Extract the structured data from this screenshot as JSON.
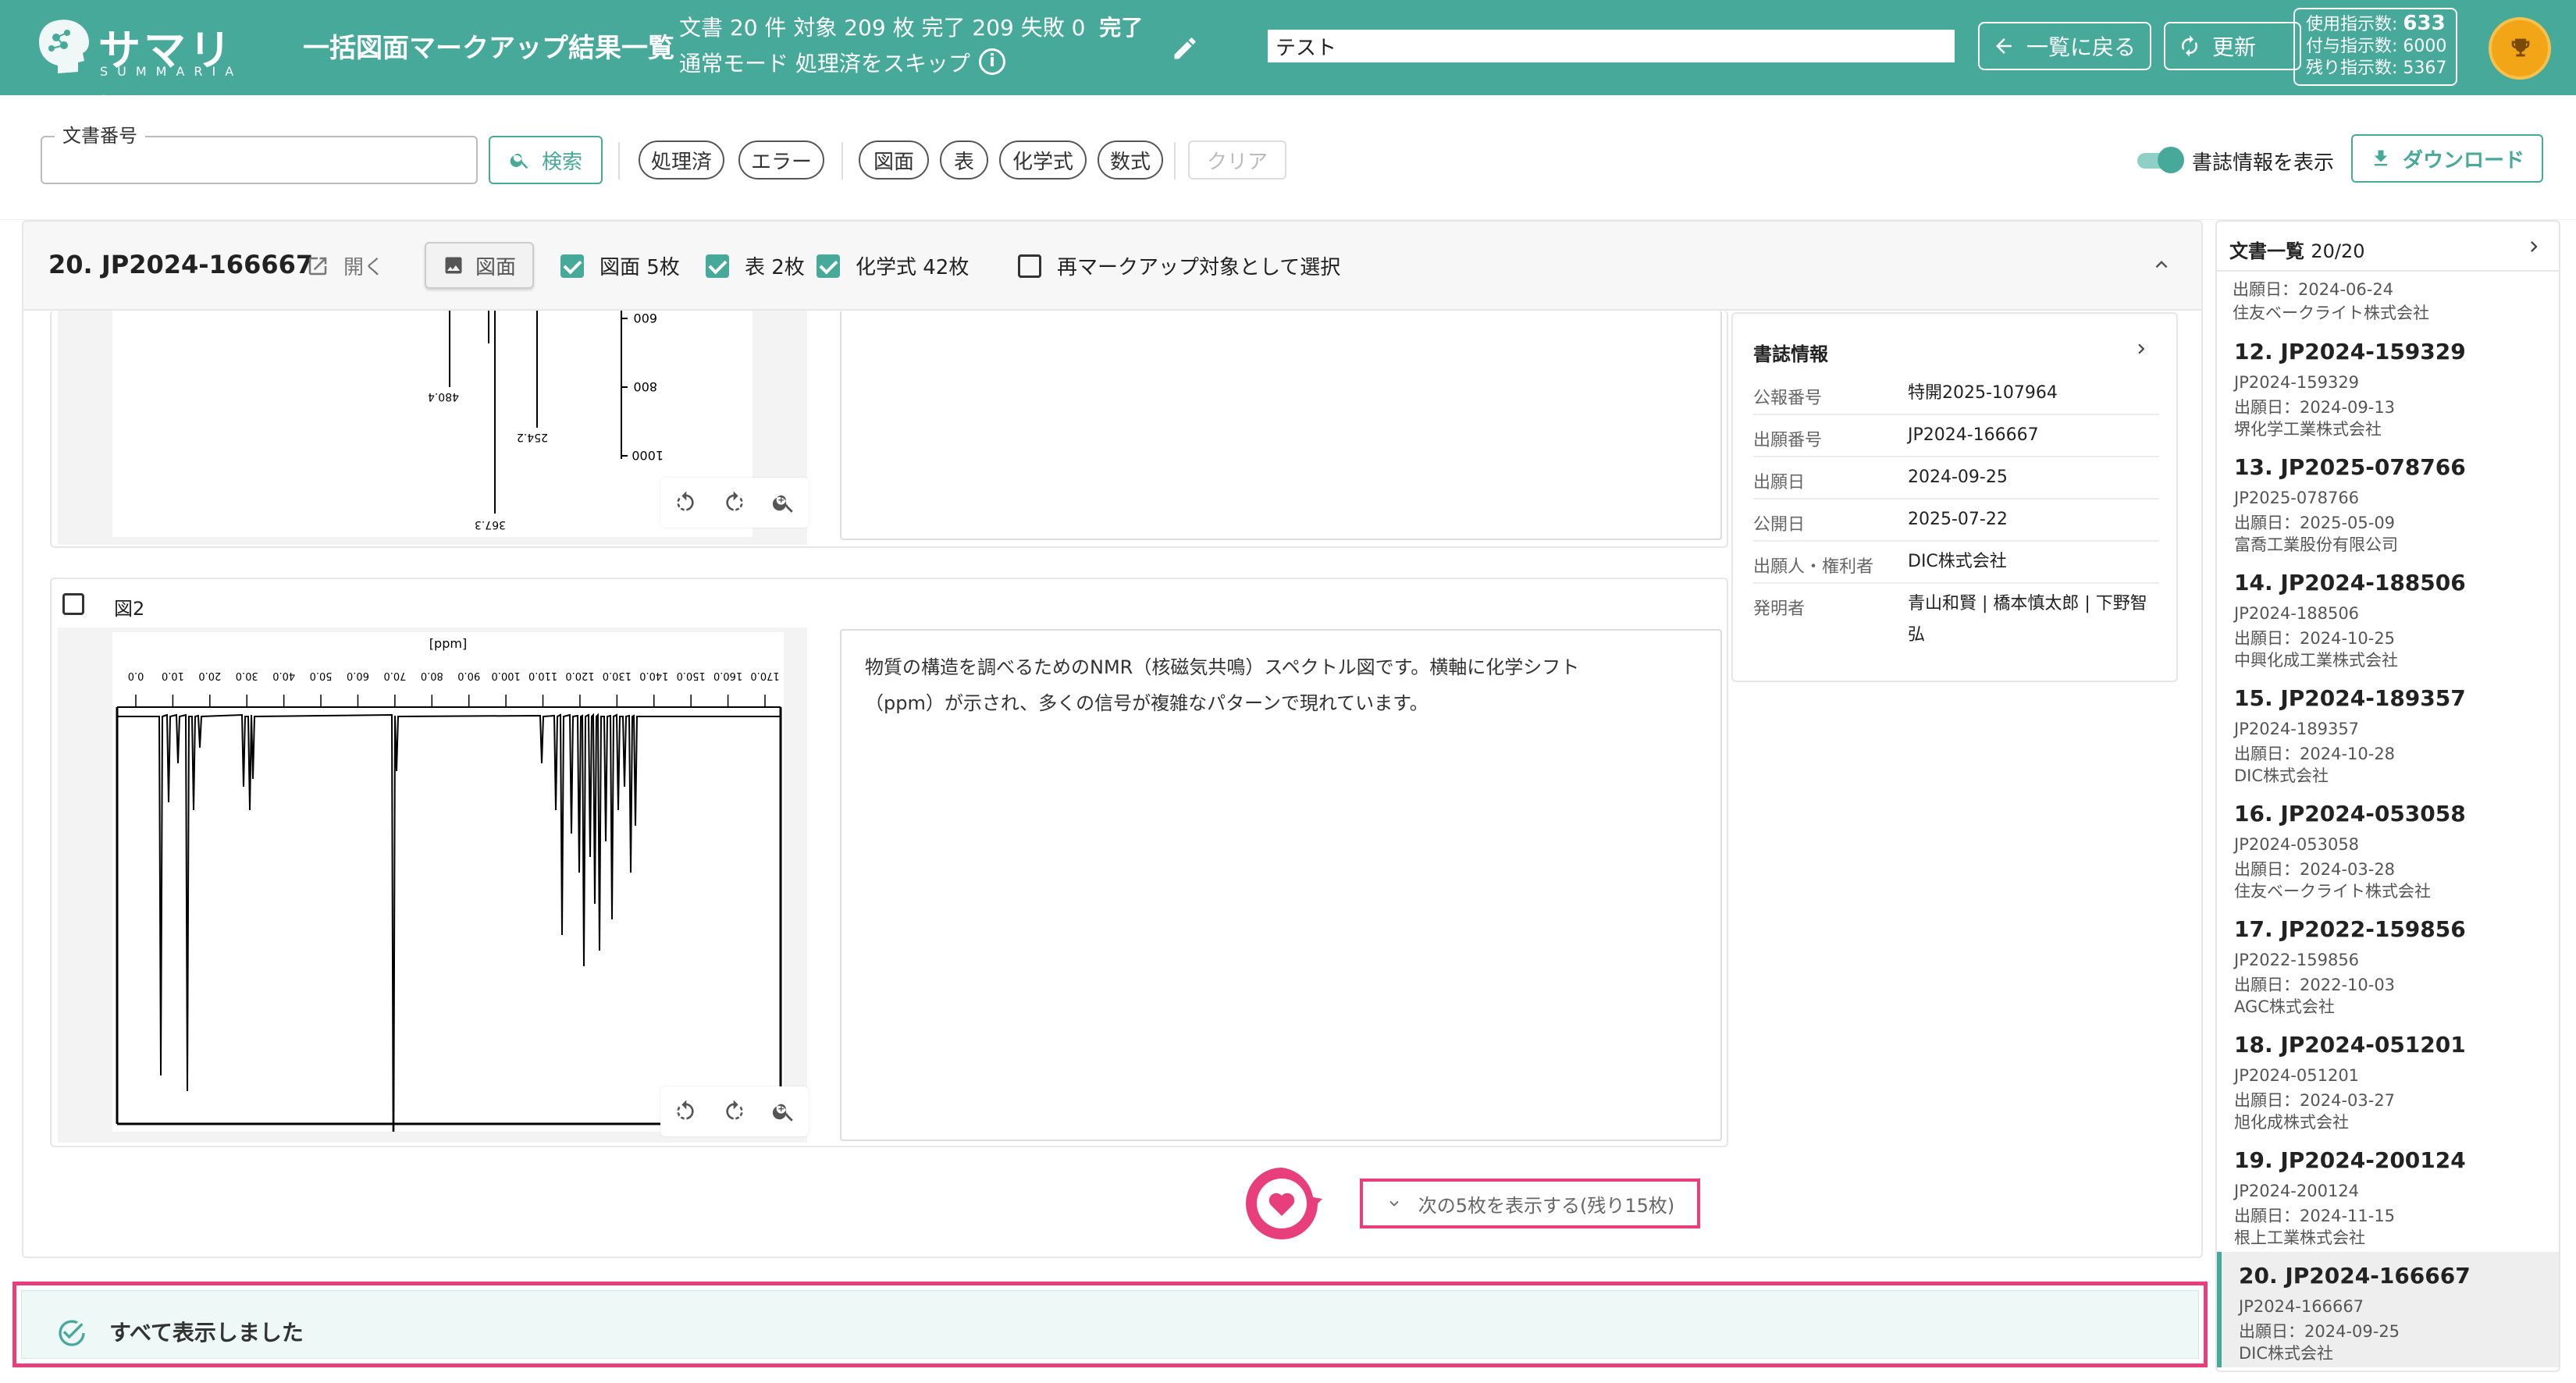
{
  "header": {
    "logo_text": "サマリア",
    "logo_sub": "SUMMARIA",
    "title": "一括図面マークアップ結果一覧",
    "stats_line1": "文書 20 件 対象 209 枚 完了 209 失敗 0",
    "stats_status": "完了",
    "stats_line2": "通常モード 処理済をスキップ",
    "info_icon": "i",
    "search_value": "テスト",
    "back_label": "一覧に戻る",
    "refresh_label": "更新",
    "usage_used_label": "使用指示数:",
    "usage_used": "633",
    "usage_granted_label": "付与指示数:",
    "usage_granted": "6000",
    "usage_remaining_label": "残り指示数:",
    "usage_remaining": "5367"
  },
  "filter": {
    "doc_number_label": "文書番号",
    "search_label": "検索",
    "chips": [
      "処理済",
      "エラー",
      "図面",
      "表",
      "化学式",
      "数式"
    ],
    "clear_label": "クリア",
    "toggle_label": "書誌情報を表示",
    "download_label": "ダウンロード"
  },
  "card": {
    "title": "20. JP2024-166667",
    "open_label": "開く",
    "figure_button": "図面",
    "cb_figures": "図面 5枚",
    "cb_tables": "表 2枚",
    "cb_chem": "化学式 42枚",
    "cb_remark": "再マークアップ対象として選択",
    "fig2_label": "図2",
    "fig2_desc": "物質の構造を調べるためのNMR（核磁気共鳴）スペクトル図です。横軸に化学シフト（ppm）が示され、多くの信号が複雑なパターンで現れています。",
    "fig1_ticks": [
      "600",
      "800",
      "1000"
    ],
    "fig1_peaks": [
      "480.4",
      "254.2",
      "367.3"
    ],
    "fig2_axis_title": "[ppm]",
    "fig2_ticks": [
      "0.0",
      "10.0",
      "20.0",
      "30.0",
      "40.0",
      "50.0",
      "60.0",
      "70.0",
      "80.0",
      "90.0",
      "100.0",
      "110.0",
      "120.0",
      "130.0",
      "140.0",
      "150.0",
      "160.0",
      "170.0"
    ],
    "more_label": "次の5枚を表示する(残り15枚)",
    "done_label": "すべて表示しました"
  },
  "bib": {
    "title": "書誌情報",
    "rows": [
      {
        "k": "公報番号",
        "v": "特開2025-107964"
      },
      {
        "k": "出願番号",
        "v": "JP2024-166667"
      },
      {
        "k": "出願日",
        "v": "2024-09-25"
      },
      {
        "k": "公開日",
        "v": "2025-07-22"
      },
      {
        "k": "出願人・権利者",
        "v": "DIC株式会社"
      },
      {
        "k": "発明者",
        "v": "青山和賢 | 橋本慎太郎 | 下野智弘"
      }
    ]
  },
  "sidebar": {
    "title": "文書一覧",
    "count": "20/20",
    "top_lines": [
      "出願日：2024-06-24",
      "住友ベークライト株式会社"
    ],
    "items": [
      {
        "title": "12. JP2024-159329",
        "num": "JP2024-159329",
        "date": "出願日：2024-09-13",
        "company": "堺化学工業株式会社"
      },
      {
        "title": "13. JP2025-078766",
        "num": "JP2025-078766",
        "date": "出願日：2025-05-09",
        "company": "富喬工業股份有限公司"
      },
      {
        "title": "14. JP2024-188506",
        "num": "JP2024-188506",
        "date": "出願日：2024-10-25",
        "company": "中興化成工業株式会社"
      },
      {
        "title": "15. JP2024-189357",
        "num": "JP2024-189357",
        "date": "出願日：2024-10-28",
        "company": "DIC株式会社"
      },
      {
        "title": "16. JP2024-053058",
        "num": "JP2024-053058",
        "date": "出願日：2024-03-28",
        "company": "住友ベークライト株式会社"
      },
      {
        "title": "17. JP2022-159856",
        "num": "JP2022-159856",
        "date": "出願日：2022-10-03",
        "company": "AGC株式会社"
      },
      {
        "title": "18. JP2024-051201",
        "num": "JP2024-051201",
        "date": "出願日：2024-03-27",
        "company": "旭化成株式会社"
      },
      {
        "title": "19. JP2024-200124",
        "num": "JP2024-200124",
        "date": "出願日：2024-11-15",
        "company": "根上工業株式会社"
      },
      {
        "title": "20. JP2024-166667",
        "num": "JP2024-166667",
        "date": "出願日：2024-09-25",
        "company": "DIC株式会社"
      }
    ]
  },
  "colors": {
    "brand": "#46a99a",
    "highlight": "#e83f7c",
    "trophy": "#f2a516"
  },
  "icons": [
    "logo-head-icon",
    "info-icon",
    "pencil-icon",
    "arrow-left-icon",
    "refresh-icon",
    "trophy-icon",
    "search-icon",
    "download-icon",
    "open-external-icon",
    "image-icon",
    "chevron-up-icon",
    "rotate-left-icon",
    "rotate-right-icon",
    "zoom-in-icon",
    "heart-icon",
    "chevron-down-icon",
    "check-circle-icon",
    "chevron-right-icon"
  ]
}
